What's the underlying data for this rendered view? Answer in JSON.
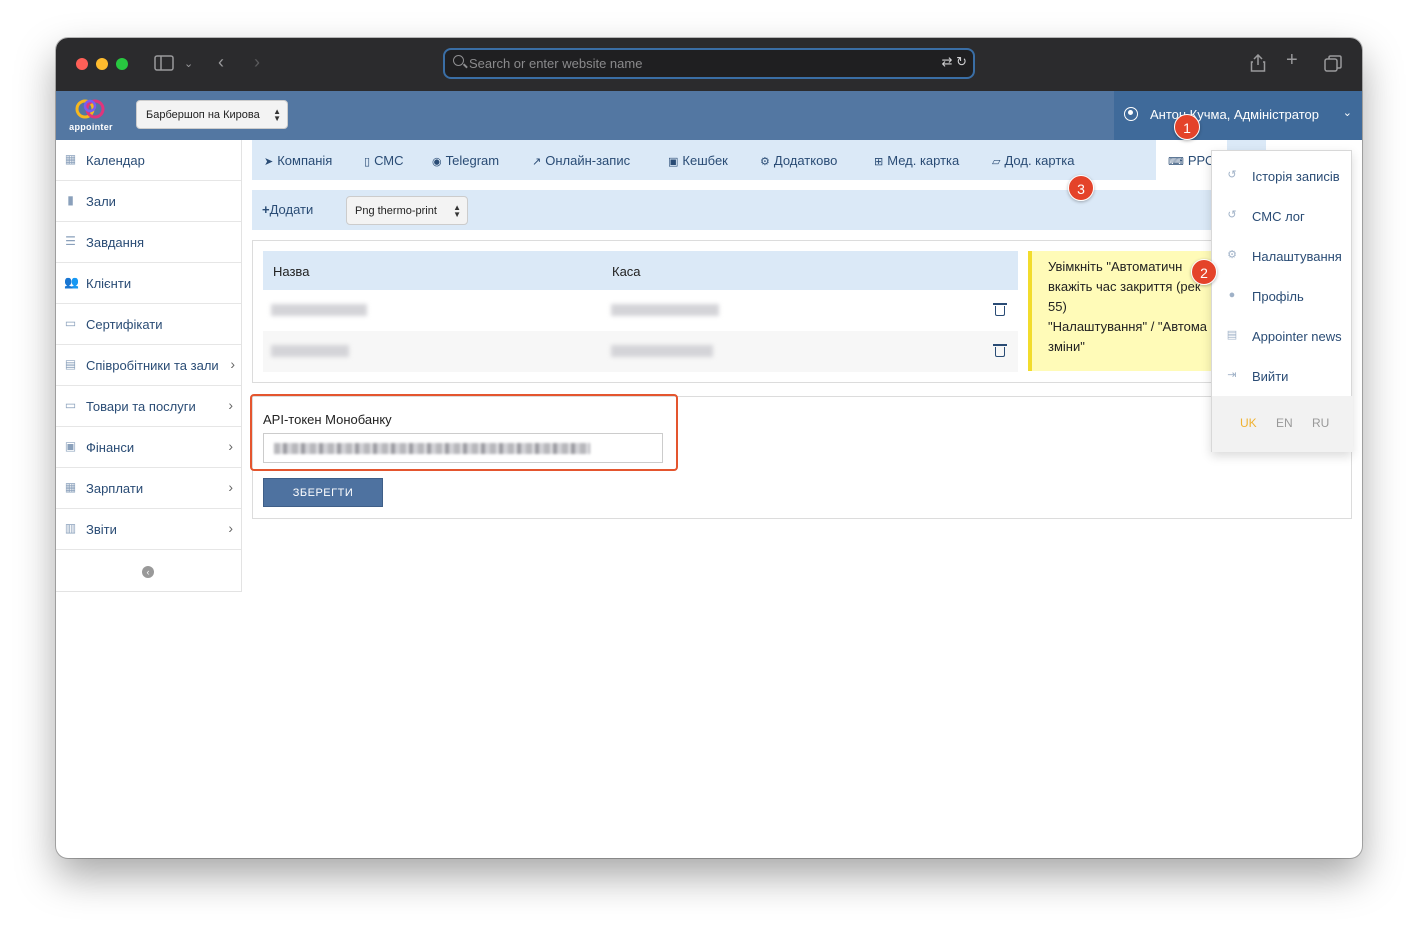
{
  "browser": {
    "url_placeholder": "Search or enter website name"
  },
  "header": {
    "logo_text": "appointer",
    "branch": "Барбершоп на Кирова",
    "user": "Антон Кучма, Адміністратор"
  },
  "sidebar": {
    "items": [
      {
        "label": "Календар",
        "icon": "calendar-icon",
        "has_arrow": false
      },
      {
        "label": "Зали",
        "icon": "bookmark-icon",
        "has_arrow": false
      },
      {
        "label": "Завдання",
        "icon": "tasks-icon",
        "has_arrow": false
      },
      {
        "label": "Клієнти",
        "icon": "users-icon",
        "has_arrow": false
      },
      {
        "label": "Сертифікати",
        "icon": "card-icon",
        "has_arrow": false
      },
      {
        "label": "Співробітники та зали",
        "icon": "id-card-icon",
        "has_arrow": true
      },
      {
        "label": "Товари та послуги",
        "icon": "card-icon",
        "has_arrow": true
      },
      {
        "label": "Фінанси",
        "icon": "money-icon",
        "has_arrow": true
      },
      {
        "label": "Зарплати",
        "icon": "calculator-icon",
        "has_arrow": true
      },
      {
        "label": "Звіти",
        "icon": "bar-chart-icon",
        "has_arrow": true
      }
    ]
  },
  "tabs": [
    {
      "label": "Компанія",
      "icon": "send-icon"
    },
    {
      "label": "СМС",
      "icon": "mobile-icon"
    },
    {
      "label": "Telegram",
      "icon": "telegram-icon"
    },
    {
      "label": "Онлайн-запис",
      "icon": "external-link-icon"
    },
    {
      "label": "Кешбек",
      "icon": "money-icon"
    },
    {
      "label": "Додатково",
      "icon": "gears-icon"
    },
    {
      "label": "Мед. картка",
      "icon": "plus-square-icon"
    },
    {
      "label": "Дод. картка",
      "icon": "folder-open-icon"
    },
    {
      "label": "РРО",
      "icon": "keyboard-icon"
    }
  ],
  "toolbar": {
    "add_label": "Додати",
    "printer": "Png thermo-print"
  },
  "table": {
    "columns": [
      "Назва",
      "Каса"
    ]
  },
  "notice": {
    "lines": [
      "Увімкніть \"Автоматичн",
      "вкажіть час закриття (рек",
      "55)",
      "\"Налаштування\" / \"Автома",
      "зміни\""
    ]
  },
  "token": {
    "label": "API-токен Монобанку",
    "save_label": "ЗБЕРЕГТИ"
  },
  "dropdown": {
    "items": [
      {
        "label": "Історія записів",
        "icon": "history-icon"
      },
      {
        "label": "СМС лог",
        "icon": "history-icon"
      },
      {
        "label": "Налаштування",
        "icon": "gears-icon"
      },
      {
        "label": "Профіль",
        "icon": "user-icon"
      },
      {
        "label": "Appointer news",
        "icon": "newspaper-icon"
      },
      {
        "label": "Вийти",
        "icon": "sign-out-icon"
      }
    ],
    "languages": [
      "UK",
      "EN",
      "RU"
    ],
    "active_language": "UK"
  },
  "callouts": [
    "1",
    "2",
    "3"
  ],
  "colors": {
    "header": "#5377a2",
    "tab_bar": "#dbe9f7",
    "highlight": "#e4552e",
    "badge": "#e4432a",
    "notice": "#fffbb8",
    "active_language": "#f0b232"
  }
}
